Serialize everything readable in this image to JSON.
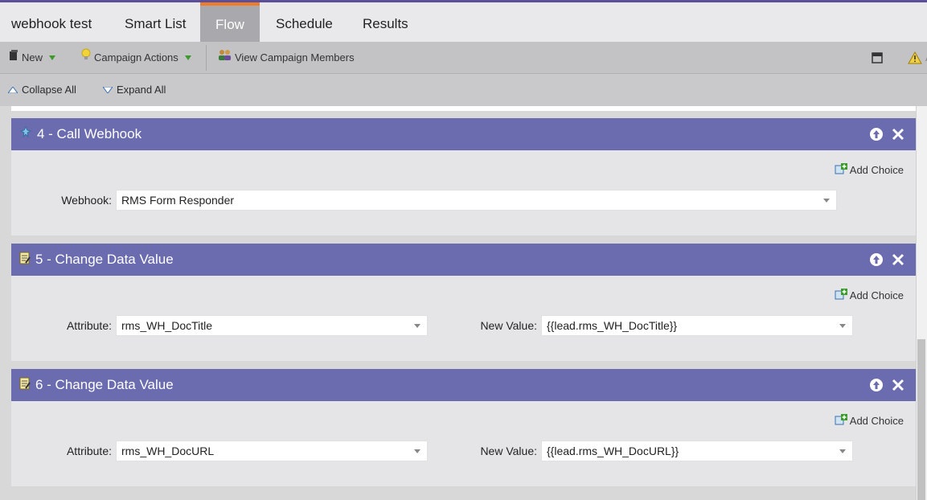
{
  "tabs": {
    "program_name": "webhook test",
    "items": [
      {
        "label": "Smart List"
      },
      {
        "label": "Flow"
      },
      {
        "label": "Schedule"
      },
      {
        "label": "Results"
      }
    ],
    "active": "Flow"
  },
  "toolbar": {
    "new_label": "New",
    "campaign_actions_label": "Campaign Actions",
    "view_members_label": "View Campaign Members"
  },
  "subbar": {
    "collapse_label": "Collapse All",
    "expand_label": "Expand All"
  },
  "steps": [
    {
      "title": "4 - Call Webhook",
      "add_choice": "Add Choice",
      "fields": [
        {
          "label": "Webhook:",
          "value": "RMS Form Responder"
        }
      ]
    },
    {
      "title": "5 - Change Data Value",
      "add_choice": "Add Choice",
      "fields": [
        {
          "label": "Attribute:",
          "value": "rms_WH_DocTitle"
        },
        {
          "label": "New Value:",
          "value": "{{lead.rms_WH_DocTitle}}"
        }
      ]
    },
    {
      "title": "6 - Change Data Value",
      "add_choice": "Add Choice",
      "fields": [
        {
          "label": "Attribute:",
          "value": "rms_WH_DocURL"
        },
        {
          "label": "New Value:",
          "value": "{{lead.rms_WH_DocURL}}"
        }
      ]
    }
  ],
  "colors": {
    "accent_tab": "#f07b28",
    "step_header": "#6b6bb0",
    "top_line": "#5b4f9c"
  }
}
